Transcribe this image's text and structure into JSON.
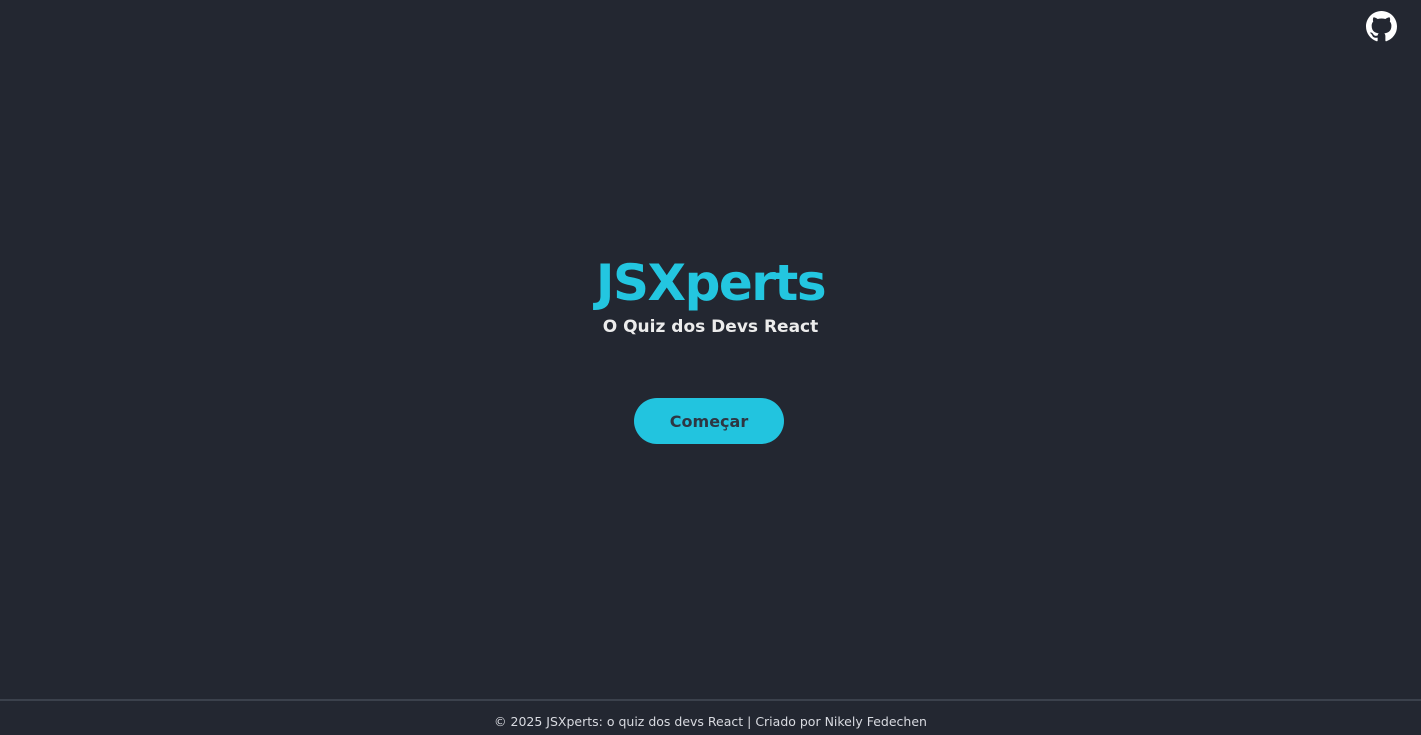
{
  "header": {
    "github_icon": "github-icon",
    "github_icon_color": "#ffffff"
  },
  "hero": {
    "title": "JSXperts",
    "subtitle": "O Quiz dos Devs React",
    "start_button_label": "Começar"
  },
  "footer": {
    "text": "© 2025 JSXperts: o quiz dos devs React | Criado por Nikely Fedechen"
  },
  "colors": {
    "background": "#232731",
    "accent": "#23c6e0",
    "subtitle": "#ececec",
    "button_text": "#2e3643",
    "footer_text": "#d8dae0",
    "divider": "#3b414c"
  }
}
